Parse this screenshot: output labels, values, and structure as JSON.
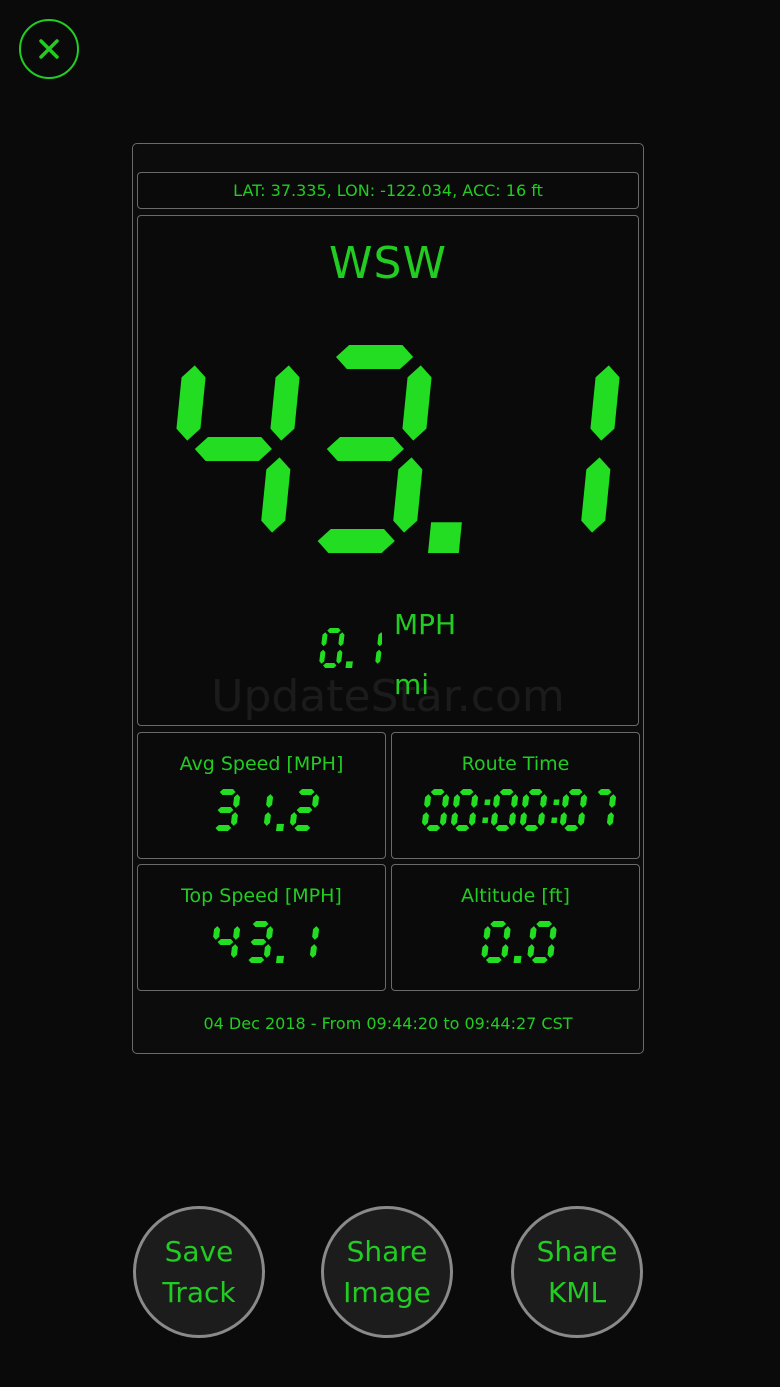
{
  "colors": {
    "accent": "#22dd22",
    "background": "#0a0a0a",
    "border": "#6a6a6a"
  },
  "close": {
    "icon": "close-icon"
  },
  "gps": {
    "text": "LAT: 37.335, LON: -122.034, ACC: 16 ft"
  },
  "heading": "WSW",
  "speed": {
    "value": "43.1",
    "unit": "MPH"
  },
  "distance": {
    "value": "0.1",
    "unit": "mi"
  },
  "watermark": "UpdateStar.com",
  "stats": [
    {
      "label": "Avg Speed [MPH]",
      "value": "31.2"
    },
    {
      "label": "Route Time",
      "value": "00:00:07"
    },
    {
      "label": "Top Speed [MPH]",
      "value": "43.1"
    },
    {
      "label": "Altitude [ft]",
      "value": "0.0"
    }
  ],
  "footer": {
    "text": "04 Dec 2018 - From 09:44:20 to 09:44:27 CST"
  },
  "buttons": [
    {
      "line1": "Save",
      "line2": "Track"
    },
    {
      "line1": "Share",
      "line2": "Image"
    },
    {
      "line1": "Share",
      "line2": "KML"
    }
  ]
}
